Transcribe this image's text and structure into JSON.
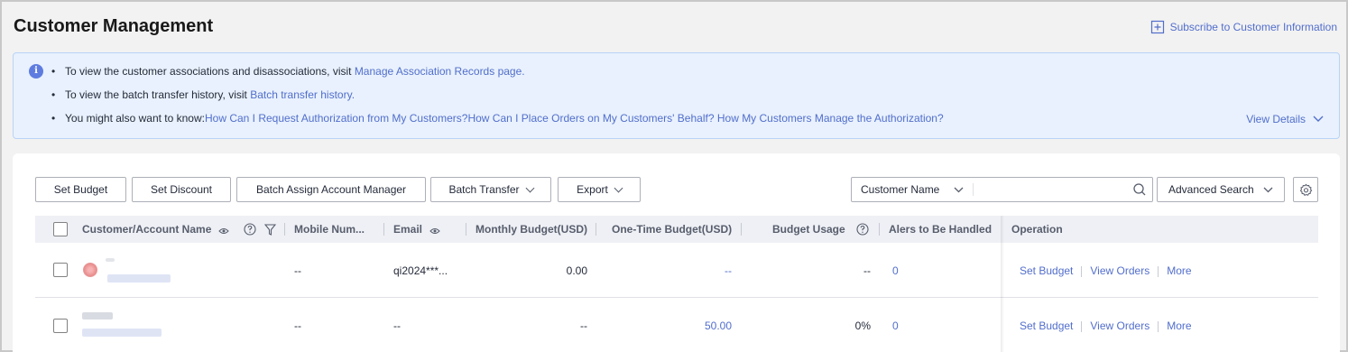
{
  "header": {
    "title": "Customer Management",
    "subscribe_label": "Subscribe to Customer Information"
  },
  "notice": {
    "line1_text": "To view the customer associations and disassociations, visit ",
    "line1_link": "Manage Association Records page.",
    "line2_text": "To view the batch transfer history, visit ",
    "line2_link": "Batch transfer history.",
    "line3_text": "You might also want to know:",
    "line3_link1": "How Can I Request Authorization from My Customers?",
    "line3_link2": "How Can I Place Orders on My Customers' Behalf?",
    "line3_link3": " How My Customers Manage the Authorization?",
    "view_details": "View Details"
  },
  "toolbar": {
    "set_budget": "Set Budget",
    "set_discount": "Set Discount",
    "batch_assign": "Batch Assign Account Manager",
    "batch_transfer": "Batch Transfer",
    "export": "Export",
    "search_field": "Customer Name",
    "search_placeholder": "",
    "advanced_search": "Advanced Search"
  },
  "table": {
    "columns": {
      "name": "Customer/Account Name",
      "mobile": "Mobile Num...",
      "email": "Email",
      "monthly_budget": "Monthly Budget(USD)",
      "one_time_budget": "One-Time Budget(USD)",
      "budget_usage": "Budget Usage",
      "alerts": "Alers to Be Handled",
      "operation": "Operation"
    },
    "rows": [
      {
        "mobile": "--",
        "email": "qi2024***...",
        "monthly_budget": "0.00",
        "one_time_budget": "--",
        "budget_usage": "--",
        "alerts": "0",
        "op_set_budget": "Set Budget",
        "op_view_orders": "View Orders",
        "op_more": "More"
      },
      {
        "mobile": "--",
        "email": "--",
        "monthly_budget": "--",
        "one_time_budget": "50.00",
        "budget_usage": "0%",
        "alerts": "0",
        "op_set_budget": "Set Budget",
        "op_view_orders": "View Orders",
        "op_more": "More"
      }
    ]
  },
  "colors": {
    "link": "#526ecc",
    "notice_bg": "#e8f1fd",
    "header_bg": "#eef0f5"
  }
}
